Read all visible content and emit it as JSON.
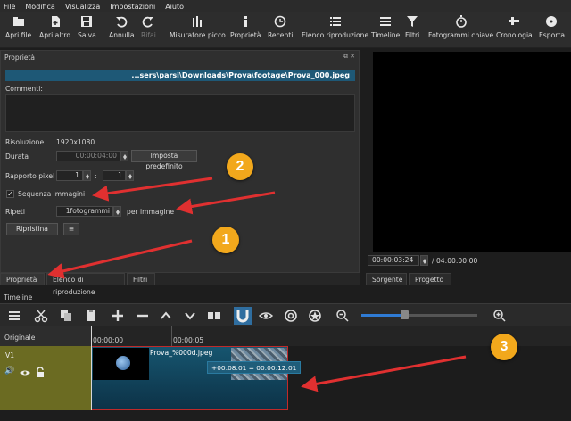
{
  "menu": [
    "File",
    "Modifica",
    "Visualizza",
    "Impostazioni",
    "Aiuto"
  ],
  "toolbar": {
    "open_file": "Apri file",
    "open_other": "Apri altro",
    "save": "Salva",
    "undo": "Annulla",
    "redo": "Rifai",
    "peak_meter": "Misuratore picco",
    "properties": "Proprietà",
    "recent": "Recenti",
    "playlist": "Elenco riproduzione",
    "timeline": "Timeline",
    "filters": "Filtri",
    "keyframes": "Fotogrammi chiave",
    "history": "Cronologia",
    "export": "Esporta"
  },
  "properties": {
    "panel_title": "Proprietà",
    "path": "...sers\\parsi\\Downloads\\Prova\\footage\\Prova_000.jpeg",
    "comments_label": "Commenti:",
    "resolution_label": "Risoluzione",
    "resolution_value": "1920x1080",
    "duration_label": "Durata",
    "duration_value": "00:00:04:00",
    "set_default_label": "Imposta predefinito",
    "pixel_ratio_label": "Rapporto pixel",
    "pixel_ratio_a": "1",
    "pixel_ratio_sep": ":",
    "pixel_ratio_b": "1",
    "image_sequence_label": "Sequenza immagini",
    "image_sequence_checked": "✓",
    "repeat_label": "Ripeti",
    "repeat_value": "1fotogrammi",
    "per_image_label": "per immagine",
    "reset_label": "Ripristina"
  },
  "panel_tabs": [
    "Proprietà",
    "Elenco di riproduzione",
    "Filtri"
  ],
  "viewer": {
    "position": "00:00:03:24",
    "duration": "/ 04:00:00:00",
    "tabs": [
      "Sorgente",
      "Progetto"
    ]
  },
  "timeline": {
    "title": "Timeline",
    "original_label": "Originale",
    "track_name": "V1",
    "ruler_labels": [
      "00:00:00",
      "00:00:05"
    ],
    "clip_name": "Prova_%000d.jpeg",
    "tooltip": "+00:08:01 = 00:00:12:01",
    "zoom_fraction": 0.36
  },
  "annotations": [
    "1",
    "2",
    "3"
  ],
  "colors": {
    "accent_blue": "#1e5876",
    "badge_orange": "#f2a81c",
    "arrow_red": "#e03030",
    "track_olive": "#6b6b22"
  }
}
